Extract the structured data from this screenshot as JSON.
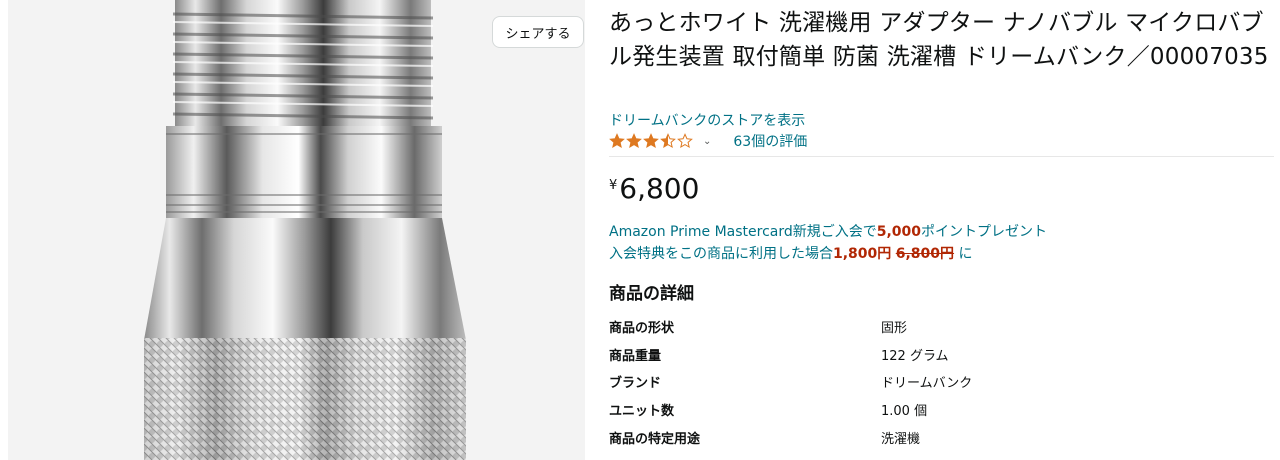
{
  "share_button": {
    "label": "シェアする"
  },
  "product": {
    "title": "あっとホワイト 洗濯機用 アダプター ナノバブル マイクロバブル発生装置 取付簡単 防菌 洗濯槽 ドリームバンク／00007035",
    "store_link": "ドリームバンクのストアを表示",
    "rating": {
      "stars_value": 3.5,
      "stars_max": 5,
      "count_label": "63個の評価"
    },
    "price": {
      "currency": "¥",
      "amount": "6,800"
    }
  },
  "promo": {
    "line1_prefix": "Amazon Prime Mastercard新規ご入会で",
    "line1_points": "5,000",
    "line1_suffix": "ポイントプレゼント",
    "line2_prefix": "入会特典をこの商品に利用した場合",
    "line2_price": "1,800円",
    "line2_old_price": "6,800円",
    "line2_suffix": "に"
  },
  "details": {
    "heading": "商品の詳細",
    "rows": [
      {
        "key": "商品の形状",
        "value": "固形"
      },
      {
        "key": "商品重量",
        "value": "122 グラム"
      },
      {
        "key": "ブランド",
        "value": "ドリームバンク"
      },
      {
        "key": "ユニット数",
        "value": "1.00 個"
      },
      {
        "key": "商品の特定用途",
        "value": "洗濯機"
      }
    ]
  },
  "colors": {
    "link": "#007185",
    "price_red": "#b12704",
    "star": "#de7921",
    "text": "#0f1111"
  },
  "icons": {
    "star": "star-icon",
    "caret": "chevron-down-icon"
  }
}
